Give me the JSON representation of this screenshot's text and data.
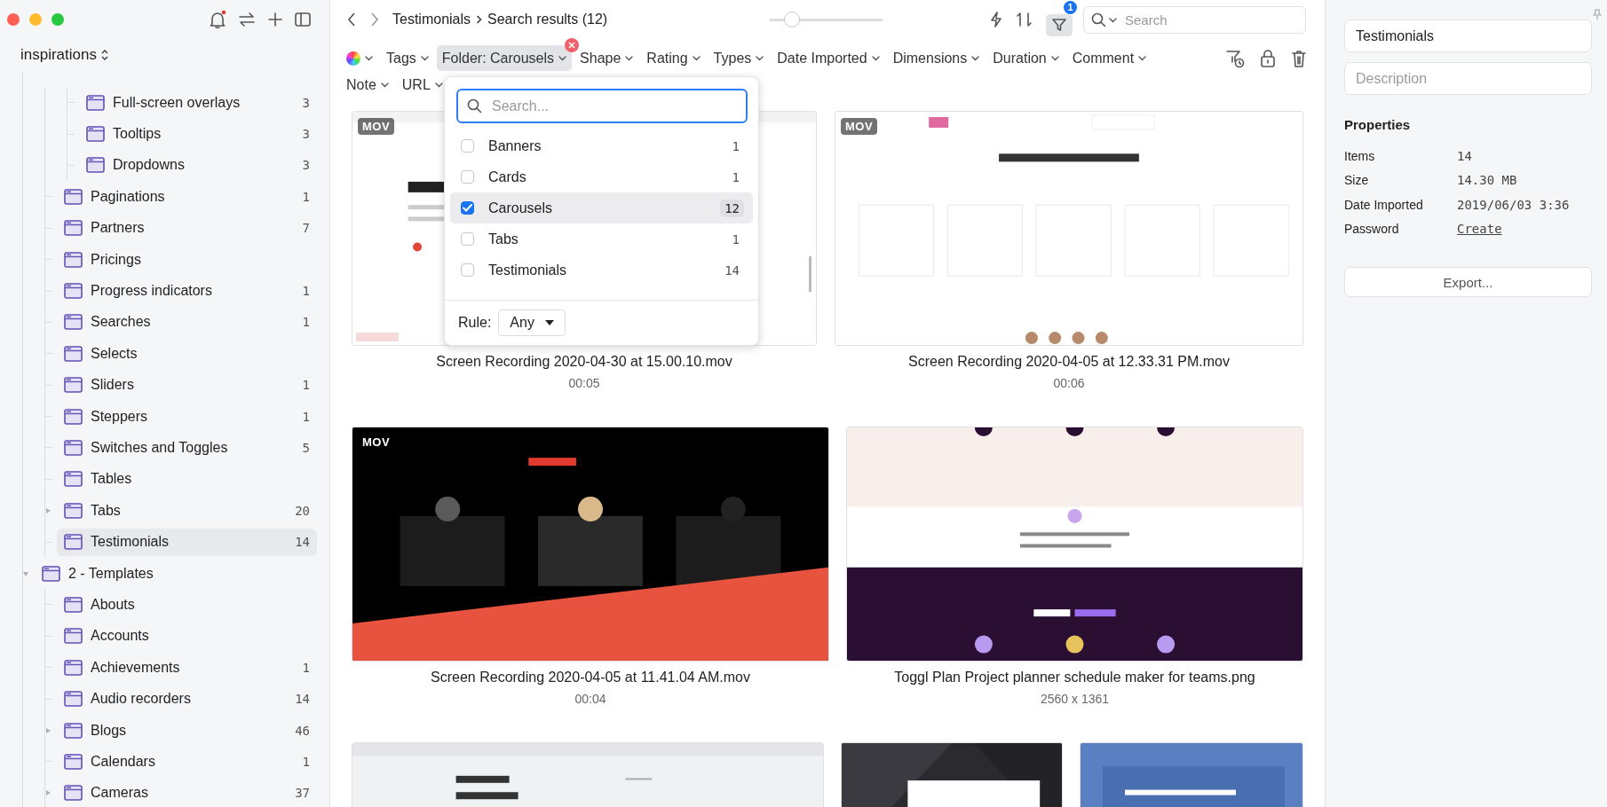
{
  "sidebar": {
    "library": "inspirations",
    "items": [
      {
        "children": [
          {
            "children": [
              {
                "label": "Full-screen overlays",
                "count": "3",
                "selected": false
              },
              {
                "label": "Tooltips",
                "count": "3",
                "selected": false
              },
              {
                "label": "Dropdowns",
                "count": "3",
                "selected": false
              }
            ]
          },
          {
            "label": "Paginations",
            "count": "1",
            "selected": false
          },
          {
            "label": "Partners",
            "count": "7",
            "selected": false
          },
          {
            "label": "Pricings",
            "selected": false
          },
          {
            "label": "Progress indicators",
            "count": "1",
            "selected": false
          },
          {
            "label": "Searches",
            "count": "1",
            "selected": false
          },
          {
            "label": "Selects",
            "selected": false
          },
          {
            "label": "Sliders",
            "count": "1",
            "selected": false
          },
          {
            "label": "Steppers",
            "count": "1",
            "selected": false
          },
          {
            "label": "Switches and Toggles",
            "count": "5",
            "selected": false
          },
          {
            "label": "Tables",
            "selected": false
          },
          {
            "label": "Tabs",
            "count": "20",
            "expanded": false,
            "selected": false
          },
          {
            "label": "Testimonials",
            "count": "14",
            "selected": true
          }
        ]
      },
      {
        "label": "2 - Templates",
        "expanded": true,
        "selected": false,
        "children": [
          {
            "label": "Abouts",
            "selected": false
          },
          {
            "label": "Accounts",
            "selected": false
          },
          {
            "label": "Achievements",
            "count": "1",
            "selected": false
          },
          {
            "label": "Audio recorders",
            "count": "14",
            "selected": false
          },
          {
            "label": "Blogs",
            "count": "46",
            "expanded": false,
            "selected": false
          },
          {
            "label": "Calendars",
            "count": "1",
            "selected": false
          },
          {
            "label": "Cameras",
            "count": "37",
            "expanded": false,
            "selected": false
          }
        ]
      }
    ]
  },
  "toolbar": {
    "breadcrumb": [
      "Testimonials",
      "Search results (12)"
    ],
    "zoom": {
      "level": 0.2
    },
    "filter_active": true,
    "filter_badge": "1",
    "search": {
      "placeholder": "Search"
    }
  },
  "filters": {
    "items": [
      {
        "kind": "color",
        "active": false
      },
      {
        "kind": "text",
        "label": "Tags",
        "active": false
      },
      {
        "kind": "text",
        "label": "Folder: Carousels",
        "active": true
      },
      {
        "kind": "text",
        "label": "Shape",
        "active": false
      },
      {
        "kind": "text",
        "label": "Rating",
        "active": false
      },
      {
        "kind": "text",
        "label": "Types",
        "active": false
      },
      {
        "kind": "text",
        "label": "Date Imported",
        "active": false
      },
      {
        "kind": "text",
        "label": "Dimensions",
        "active": false
      },
      {
        "kind": "text",
        "label": "Duration",
        "active": false
      },
      {
        "kind": "text",
        "label": "Comment",
        "active": false
      },
      {
        "kind": "text",
        "label": "Note",
        "active": false
      },
      {
        "kind": "text",
        "label": "URL",
        "active": false
      }
    ]
  },
  "popover": {
    "search": {
      "placeholder": "Search..."
    },
    "options": [
      {
        "label": "Banners",
        "count": "1",
        "checked": false,
        "selected": false
      },
      {
        "label": "Cards",
        "count": "1",
        "checked": false,
        "selected": false
      },
      {
        "label": "Carousels",
        "count": "12",
        "checked": true,
        "selected": true
      },
      {
        "label": "Tabs",
        "count": "1",
        "checked": false,
        "selected": false
      },
      {
        "label": "Testimonials",
        "count": "14",
        "checked": false,
        "selected": false
      }
    ],
    "rule": {
      "label": "Rule:",
      "value": "Any"
    }
  },
  "grid": {
    "rows": [
      {
        "cards": [
          {
            "kind": "file",
            "badge": "MOV",
            "title": "Screen Recording 2020-04-30 at 15.00.10.mov",
            "meta": "00:05"
          },
          {
            "kind": "file",
            "badge": "MOV",
            "title": "Screen Recording 2020-04-05 at 12.33.31 PM.mov",
            "meta": "00:06"
          }
        ]
      },
      {
        "cards": [
          {
            "kind": "file",
            "badge": "MOV",
            "title": "Screen Recording 2020-04-05 at 11.41.04 AM.mov",
            "meta": "00:04"
          },
          {
            "kind": "file",
            "title": "Toggl Plan Project planner schedule maker for teams.png",
            "meta": "2560 x 1361"
          }
        ]
      },
      {
        "cards": [
          {
            "kind": "picture"
          },
          {
            "kind": "picture"
          },
          {
            "kind": "picture"
          }
        ]
      }
    ]
  },
  "panel": {
    "name": {
      "value": "Testimonials"
    },
    "description": {
      "placeholder": "Description"
    },
    "properties_title": "Properties",
    "properties": [
      {
        "label": "Items",
        "value": "14",
        "kind": "text"
      },
      {
        "label": "Size",
        "value": "14.30 MB",
        "kind": "text"
      },
      {
        "label": "Date Imported",
        "value": "2019/06/03 3:36",
        "kind": "text"
      },
      {
        "label": "Password",
        "value": "Create",
        "kind": "link"
      }
    ],
    "export": "Export..."
  }
}
